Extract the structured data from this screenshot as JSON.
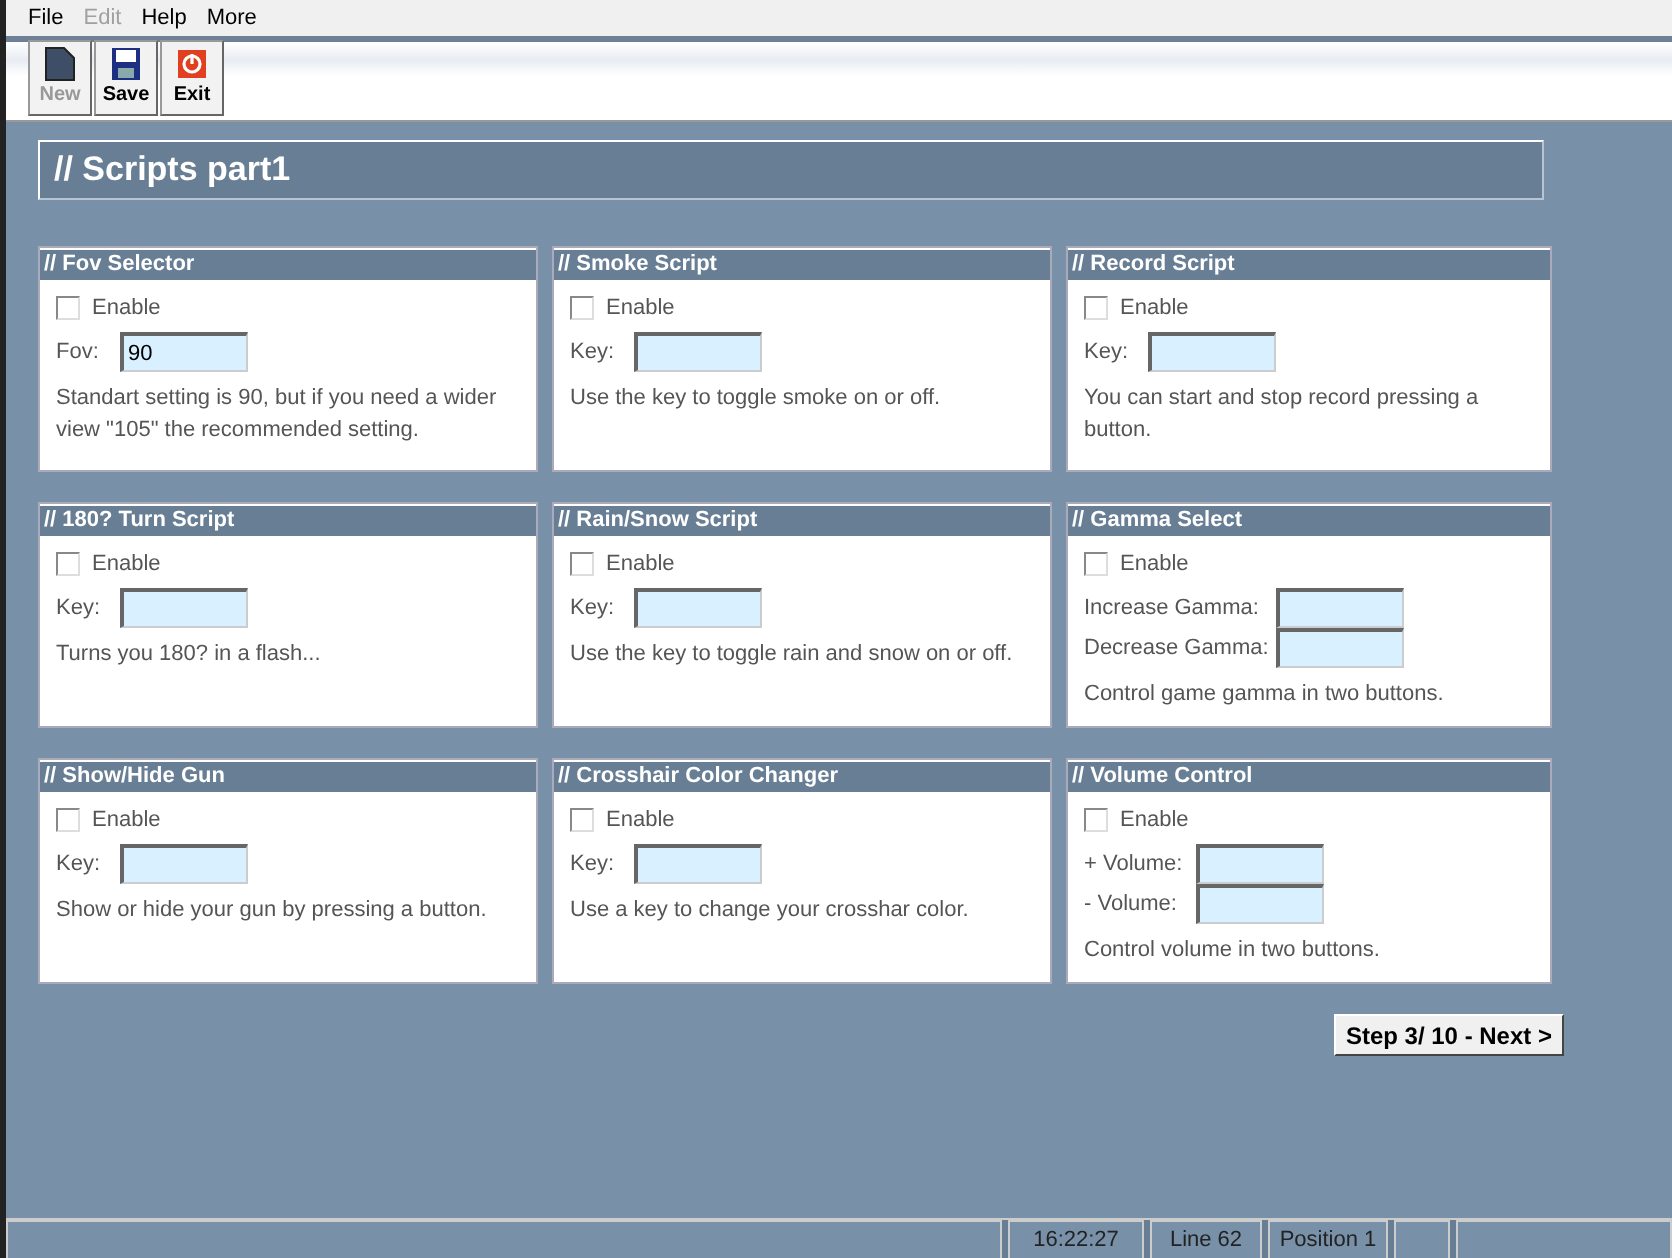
{
  "menu": [
    {
      "label": "File",
      "disabled": false
    },
    {
      "label": "Edit",
      "disabled": true
    },
    {
      "label": "Help",
      "disabled": false
    },
    {
      "label": "More",
      "disabled": false
    }
  ],
  "toolbar": [
    {
      "label": "New",
      "kind": "new",
      "disabled": true
    },
    {
      "label": "Save",
      "kind": "save",
      "disabled": false
    },
    {
      "label": "Exit",
      "kind": "exit",
      "disabled": false
    }
  ],
  "page_title": "// Scripts part1",
  "panels": [
    {
      "title": "// Fov Selector",
      "enable": {
        "label": "Enable",
        "checked": false
      },
      "fields": [
        {
          "label": "Fov:",
          "value": "90"
        }
      ],
      "description": "Standart setting is 90, but if you need a wider view \"105\" the recommended setting."
    },
    {
      "title": "// Smoke Script",
      "enable": {
        "label": "Enable",
        "checked": false
      },
      "fields": [
        {
          "label": "Key:"
        }
      ],
      "description": "Use the key to toggle smoke on or off."
    },
    {
      "title": "// Record Script",
      "enable": {
        "label": "Enable",
        "checked": false
      },
      "fields": [
        {
          "label": "Key:"
        }
      ],
      "description": "You can start and stop record pressing a button."
    },
    {
      "title": "// 180? Turn Script",
      "enable": {
        "label": "Enable",
        "checked": false
      },
      "fields": [
        {
          "label": "Key:"
        }
      ],
      "description": "Turns you 180? in a flash..."
    },
    {
      "title": "// Rain/Snow Script",
      "enable": {
        "label": "Enable",
        "checked": false
      },
      "fields": [
        {
          "label": "Key:"
        }
      ],
      "description": "Use the key to toggle rain and snow on or off."
    },
    {
      "title": "// Gamma Select",
      "enable": {
        "label": "Enable",
        "checked": false
      },
      "fields": [
        {
          "label": "Increase Gamma:"
        },
        {
          "label": "Decrease Gamma:"
        }
      ],
      "description": "Control game gamma in two buttons."
    },
    {
      "title": "// Show/Hide Gun",
      "enable": {
        "label": "Enable",
        "checked": false
      },
      "fields": [
        {
          "label": "Key:"
        }
      ],
      "description": "Show or hide your gun by pressing a button."
    },
    {
      "title": "// Crosshair Color Changer",
      "enable": {
        "label": "Enable",
        "checked": false
      },
      "fields": [
        {
          "label": "Key:"
        }
      ],
      "description": "Use a key to change your crosshar color."
    },
    {
      "title": "// Volume Control",
      "enable": {
        "label": "Enable",
        "checked": false
      },
      "fields": [
        {
          "label": "+ Volume:"
        },
        {
          "label": "- Volume:"
        }
      ],
      "description": "Control volume in two buttons."
    }
  ],
  "next_button": "Step 3/ 10 - Next >",
  "status_bar": [
    "16:22:27",
    "Line 62",
    "Position 1"
  ]
}
